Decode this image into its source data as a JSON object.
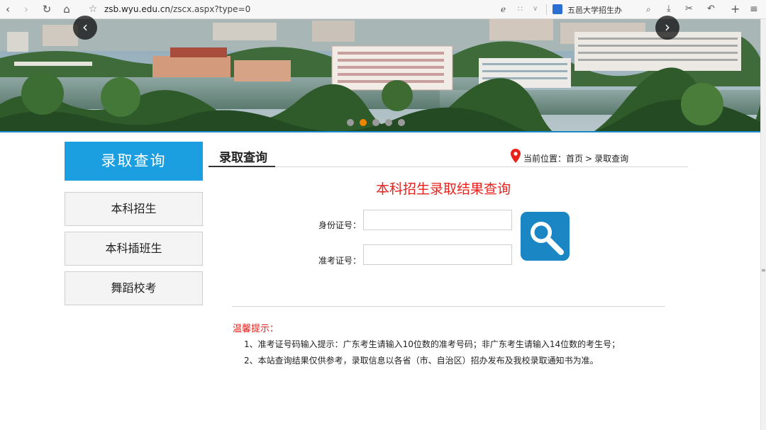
{
  "browser": {
    "url_host": "zsb.wyu.edu.cn",
    "url_path": "/zscx.aspx?type=0",
    "site_label": "五邑大学招生办",
    "accent_color": "#2a6fd1"
  },
  "banner": {
    "slides": 5,
    "active_slide": 2,
    "border_color": "#1a88c9"
  },
  "sidebar": {
    "heading": "录取查询",
    "heading_color": "#1b9fe0",
    "items": [
      {
        "label": "本科招生"
      },
      {
        "label": "本科插班生"
      },
      {
        "label": "舞蹈校考"
      }
    ]
  },
  "main": {
    "title": "录取查询",
    "breadcrumb": {
      "prefix": "当前位置：",
      "home": "首页",
      "separator": ">",
      "current": "录取查询"
    },
    "query_title": "本科招生录取结果查询",
    "form": {
      "id_label": "身份证号：",
      "id_value": "",
      "exam_label": "准考证号：",
      "exam_value": ""
    },
    "tips": {
      "heading": "温馨提示：",
      "items": [
        "1、准考证号码输入提示：广东考生请输入10位数的准考号码；非广东考生请输入14位数的考生号；",
        "2、本站查询结果仅供参考，录取信息以各省（市、自治区）招办发布及我校录取通知书为准。"
      ]
    }
  },
  "colors": {
    "title_red": "#e8211c",
    "search_button": "#1a86c4",
    "active_dot": "#f08300"
  }
}
